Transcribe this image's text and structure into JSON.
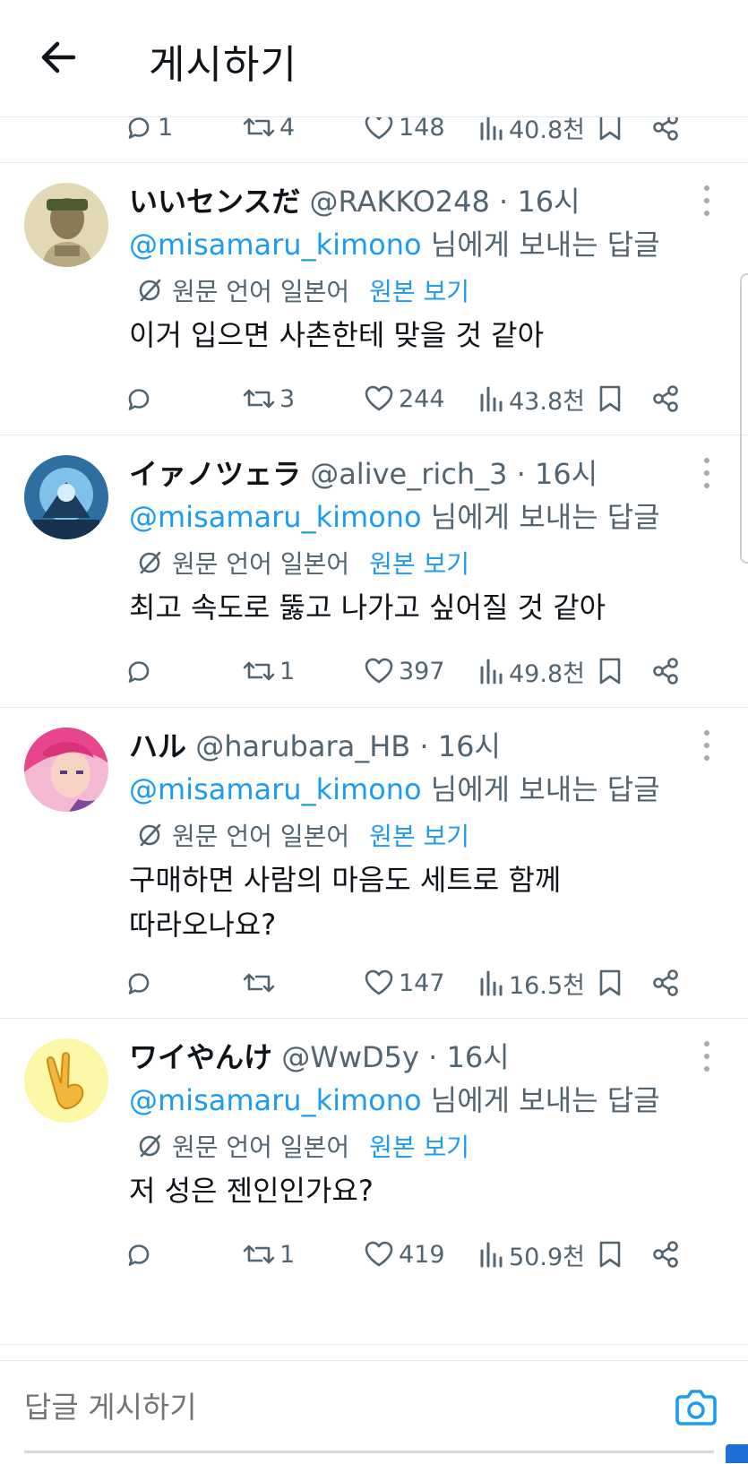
{
  "header": {
    "title": "게시하기"
  },
  "top_tweet_actions": {
    "replies": "1",
    "retweets": "4",
    "likes": "148",
    "views": "40.8천"
  },
  "tweets": [
    {
      "name": "いいセンスだ",
      "handle": "@RAKKO248 · 16시",
      "reply_to": "@misamaru_kimono",
      "reply_suffix": " 님에게 보내는 답글",
      "translate_label": "원문 언어 일본어",
      "translate_action": "원본 보기",
      "text": "이거 입으면 사촌한테 맞을 것 같아",
      "actions": {
        "replies": "",
        "retweets": "3",
        "likes": "244",
        "views": "43.8천"
      }
    },
    {
      "name": "イァノツェラ",
      "handle": "@alive_rich_3 · 16시",
      "reply_to": "@misamaru_kimono",
      "reply_suffix": " 님에게 보내는 답글",
      "translate_label": "원문 언어 일본어",
      "translate_action": "원본 보기",
      "text": "최고 속도로 뚫고 나가고 싶어질 것 같아",
      "actions": {
        "replies": "",
        "retweets": "1",
        "likes": "397",
        "views": "49.8천"
      }
    },
    {
      "name": "ハル",
      "handle": "@harubara_HB · 16시",
      "reply_to": "@misamaru_kimono",
      "reply_suffix": " 님에게 보내는 답글",
      "translate_label": "원문 언어 일본어",
      "translate_action": "원본 보기",
      "text_line1": "구매하면 사람의 마음도 세트로 함께",
      "text_line2": "따라오나요?",
      "actions": {
        "replies": "",
        "retweets": "",
        "likes": "147",
        "views": "16.5천"
      }
    },
    {
      "name": "ワイやんけ",
      "handle": "@WwD5y · 16시",
      "reply_to": "@misamaru_kimono",
      "reply_suffix": " 님에게 보내는 답글",
      "translate_label": "원문 언어 일본어",
      "translate_action": "원본 보기",
      "text": "저 성은 젠인인가요?",
      "actions": {
        "replies": "",
        "retweets": "1",
        "likes": "419",
        "views": "50.9천"
      }
    }
  ],
  "compose": {
    "placeholder": "답글 게시하기"
  },
  "icons": {
    "back": "arrow-left-icon",
    "reply": "speech-bubble-icon",
    "retweet": "retweet-icon",
    "like": "heart-icon",
    "views": "bar-chart-icon",
    "bookmark": "bookmark-icon",
    "share": "share-icon",
    "more": "vertical-dots-icon",
    "translate": "no-translate-icon",
    "camera": "camera-icon"
  },
  "colors": {
    "accent": "#1d9bf0",
    "secondary_text": "#536471",
    "divider": "#e6e9ec"
  }
}
